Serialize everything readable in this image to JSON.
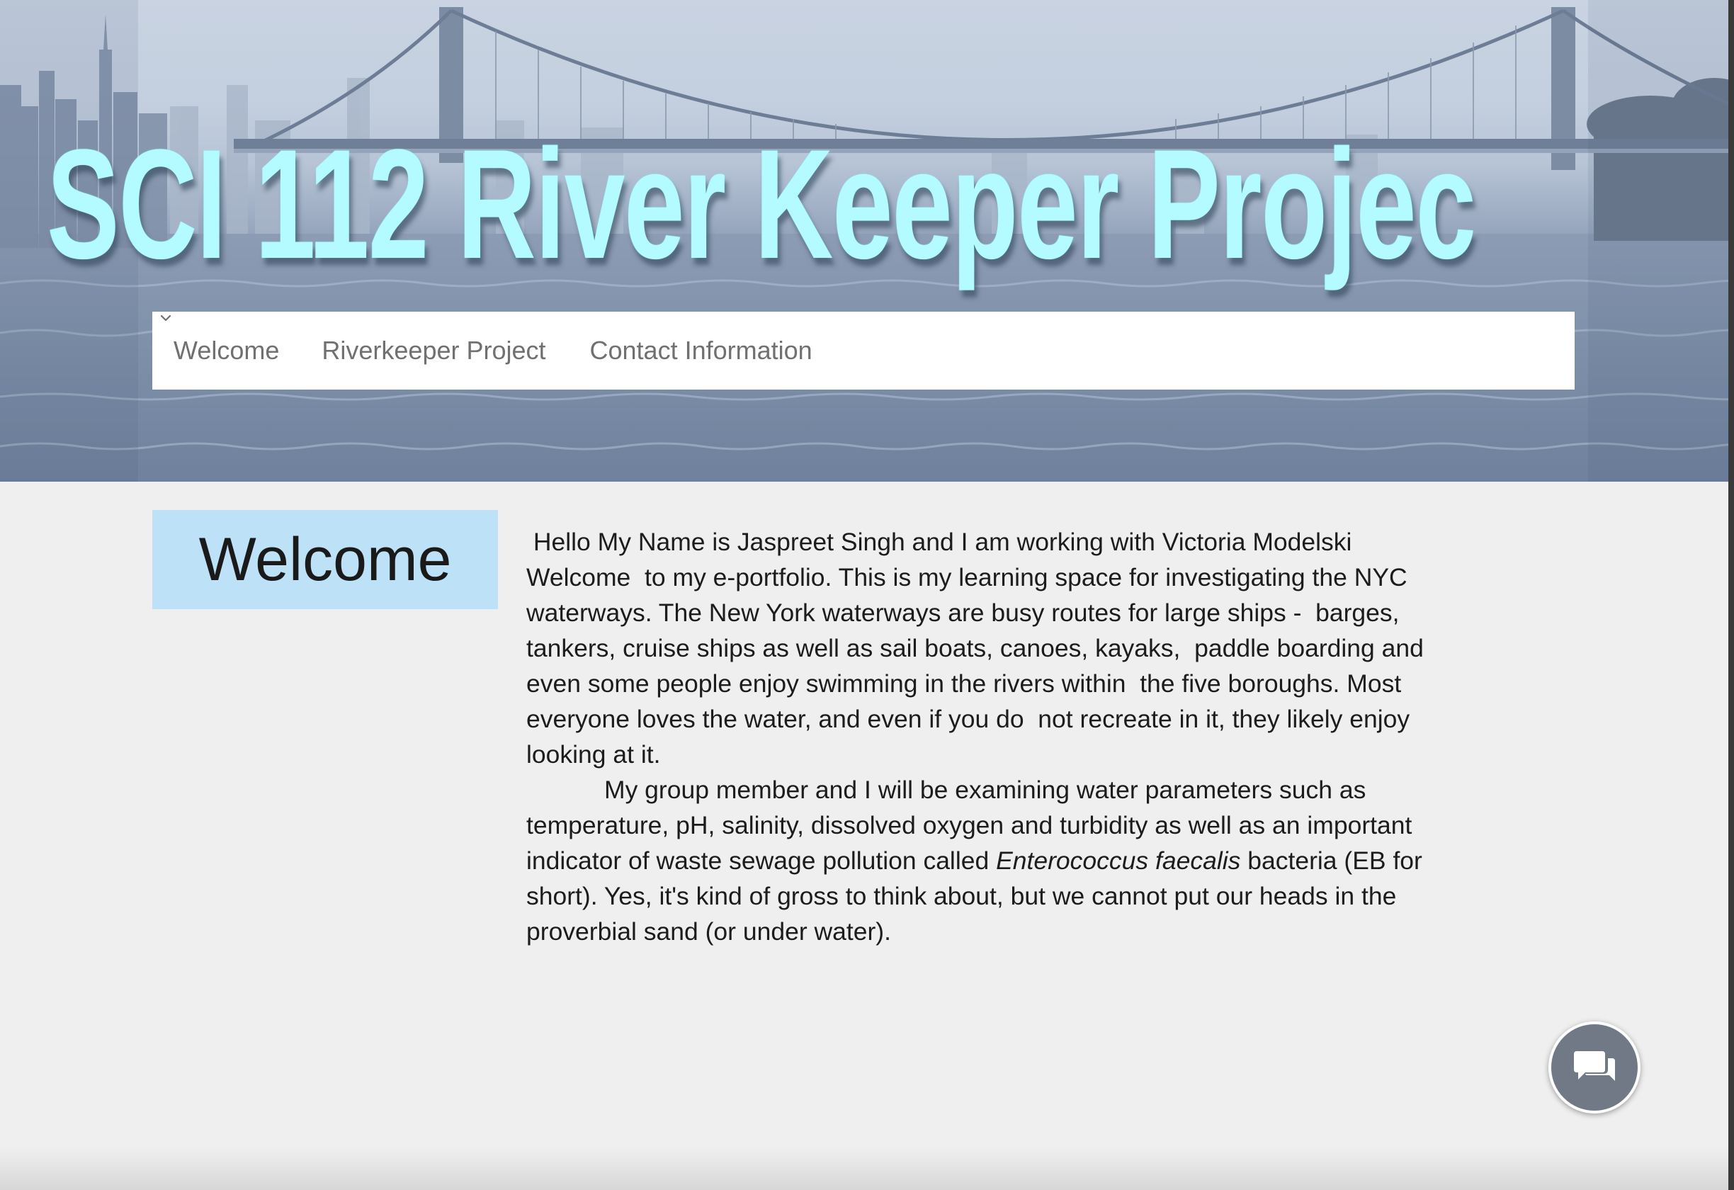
{
  "header": {
    "banner_title": "SCI 112 River Keeper Projec"
  },
  "nav": {
    "items": [
      {
        "label": "Welcome"
      },
      {
        "label": "Riverkeeper Project",
        "has_dropdown": true
      },
      {
        "label": "Contact Information"
      }
    ]
  },
  "main": {
    "heading": "Welcome",
    "paragraph1": " Hello My Name is Jaspreet Singh and I am working with Victoria Modelski Welcome  to my e-portfolio. This is my learning space for investigating the NYC waterways. The New York waterways are busy routes for large ships -  barges, tankers, cruise ships as well as sail boats, canoes, kayaks,  paddle boarding and even some people enjoy swimming in the rivers within  the five boroughs. Most everyone loves the water, and even if you do  not recreate in it, they likely enjoy looking at it.",
    "paragraph2_before": "My group member and I will be examining water parameters such  as temperature, pH, salinity, dissolved oxygen and turbidity as well as  an important indicator of waste sewage pollution called ",
    "paragraph2_italic": "Enterococcus faecalis",
    "paragraph2_after": " bacteria (EB for short). Yes, it's kind of gross to think about, but we  cannot put our heads in the proverbial sand (or under water)."
  },
  "icons": {
    "chat": "chat-bubbles-icon",
    "dropdown": "chevron-down-icon"
  },
  "colors": {
    "title_cyan": "#b4fbff",
    "welcome_box": "#bde2f7",
    "page_bg": "#efefef",
    "chat_button": "#707985"
  }
}
